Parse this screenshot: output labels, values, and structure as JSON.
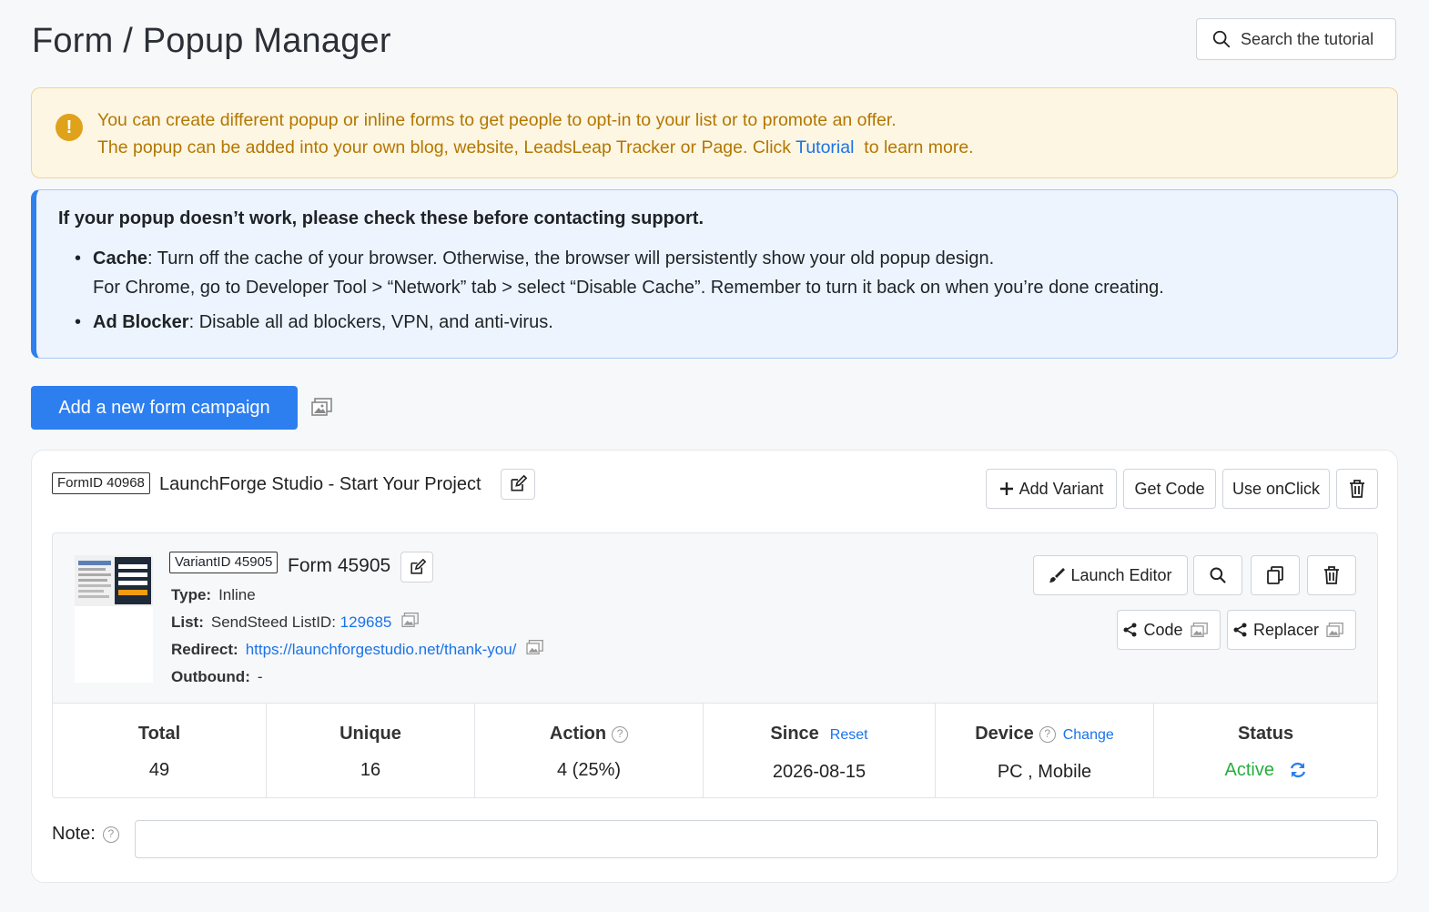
{
  "header": {
    "title": "Form / Popup Manager",
    "search_label": "Search the tutorial"
  },
  "warning": {
    "line1": "You can create different popup or inline forms to get people to opt-in to your list or to promote an offer.",
    "line2_before": "The popup can be added into your own blog, website, LeadsLeap Tracker or Page. Click ",
    "line2_link": "Tutorial",
    "line2_after": "  to learn more."
  },
  "info": {
    "title": "If your popup doesn’t work, please check these before contacting support.",
    "cache_label": "Cache",
    "cache_text": ": Turn off the cache of your browser. Otherwise, the browser will persistently show your old popup design.",
    "cache_text2": "For Chrome, go to Developer Tool > “Network” tab > select “Disable Cache”. Remember to turn it back on when you’re done creating.",
    "adblock_label": "Ad Blocker",
    "adblock_text": ": Disable all ad blockers, VPN, and anti-virus."
  },
  "add_campaign_label": "Add a new form campaign",
  "form": {
    "id_badge": "FormID 40968",
    "name": "LaunchForge Studio - Start Your Project",
    "add_variant": "Add Variant",
    "get_code": "Get Code",
    "use_onclick": "Use onClick"
  },
  "variant": {
    "id_badge": "VariantID 45905",
    "name": "Form 45905",
    "type_label": "Type:",
    "type_value": "Inline",
    "list_label": "List:",
    "list_value": "SendSteed ListID:",
    "list_id": "129685",
    "redirect_label": "Redirect:",
    "redirect_url": "https://launchforgestudio.net/thank-you/",
    "outbound_label": "Outbound:",
    "outbound_value": "-",
    "launch_editor": "Launch Editor",
    "code": "Code",
    "replacer": "Replacer"
  },
  "stats": {
    "total_label": "Total",
    "total_value": "49",
    "unique_label": "Unique",
    "unique_value": "16",
    "action_label": "Action",
    "action_value": "4 (25%)",
    "since_label": "Since",
    "since_reset": "Reset",
    "since_value": "2026-08-15",
    "device_label": "Device",
    "device_change": "Change",
    "device_value": "PC , Mobile",
    "status_label": "Status",
    "status_value": "Active"
  },
  "note": {
    "label": "Note:",
    "value": "",
    "help": "?"
  },
  "help_glyph": "?",
  "warn_glyph": "!",
  "colors": {
    "primary": "#2d7ff0",
    "active": "#27ae3f",
    "warning_text": "#b37700",
    "link": "#1a73e8"
  }
}
